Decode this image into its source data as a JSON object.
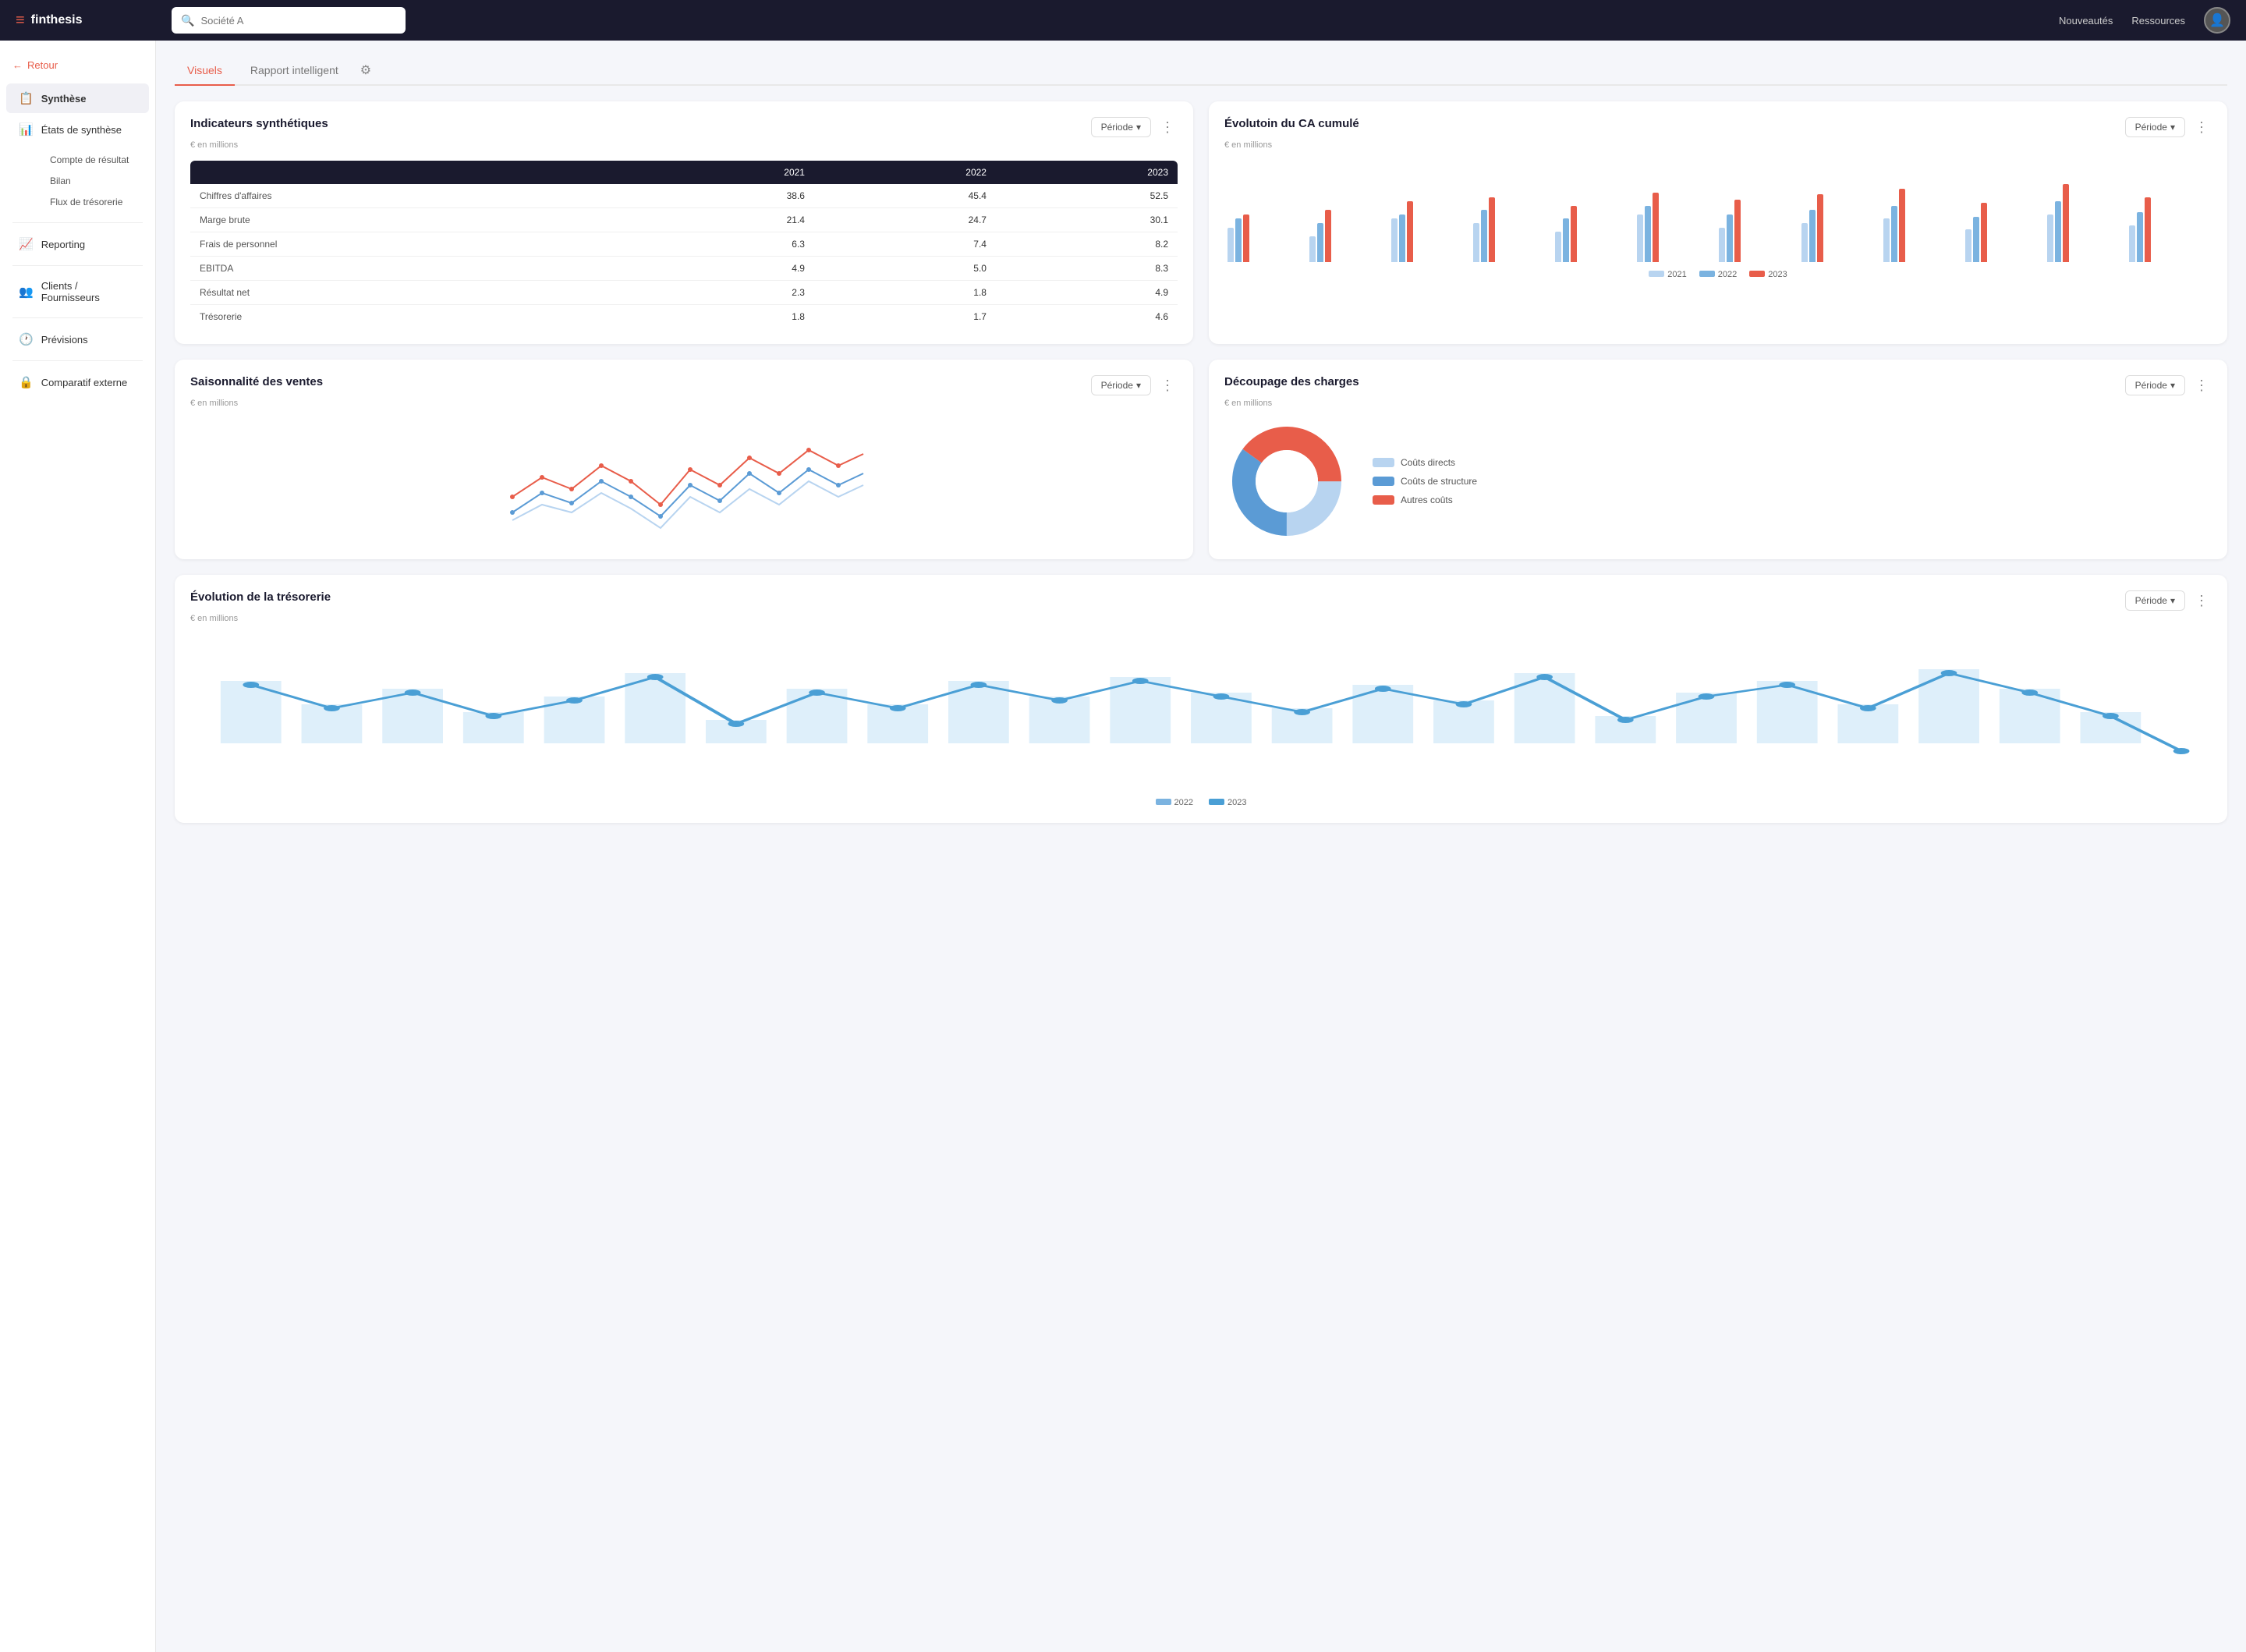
{
  "topnav": {
    "logo": "finthesis",
    "search_placeholder": "Société A",
    "nav_links": [
      "Nouveautés",
      "Ressources"
    ]
  },
  "sidebar": {
    "back_label": "Retour",
    "items": [
      {
        "id": "synthese",
        "label": "Synthèse",
        "active": true,
        "icon": "📋"
      },
      {
        "id": "etats",
        "label": "États de synthèse",
        "icon": "📊",
        "children": [
          "Compte de résultat",
          "Bilan",
          "Flux de trésorerie"
        ]
      },
      {
        "id": "reporting",
        "label": "Reporting",
        "icon": "📈"
      },
      {
        "id": "clients",
        "label": "Clients / Fournisseurs",
        "icon": "👥"
      },
      {
        "id": "previsions",
        "label": "Prévisions",
        "icon": "🕐"
      },
      {
        "id": "comparatif",
        "label": "Comparatif externe",
        "icon": "🔒"
      }
    ]
  },
  "tabs": {
    "items": [
      "Visuels",
      "Rapport intelligent"
    ],
    "active": 0
  },
  "indicateurs": {
    "title": "Indicateurs synthétiques",
    "subtitle": "€ en millions",
    "period_label": "Période",
    "columns": [
      "",
      "2021",
      "2022",
      "2023"
    ],
    "rows": [
      {
        "label": "Chiffres d'affaires",
        "v2021": "38.6",
        "v2022": "45.4",
        "v2023": "52.5"
      },
      {
        "label": "Marge brute",
        "v2021": "21.4",
        "v2022": "24.7",
        "v2023": "30.1"
      },
      {
        "label": "Frais de personnel",
        "v2021": "6.3",
        "v2022": "7.4",
        "v2023": "8.2"
      },
      {
        "label": "EBITDA",
        "v2021": "4.9",
        "v2022": "5.0",
        "v2023": "8.3"
      },
      {
        "label": "Résultat net",
        "v2021": "2.3",
        "v2022": "1.8",
        "v2023": "4.9"
      },
      {
        "label": "Trésorerie",
        "v2021": "1.8",
        "v2022": "1.7",
        "v2023": "4.6"
      }
    ]
  },
  "ca_cumule": {
    "title": "Évolutoin du CA cumulé",
    "subtitle": "€ en millions",
    "period_label": "Période",
    "legend": [
      "2021",
      "2022",
      "2023"
    ],
    "bar_groups": [
      {
        "y2021": 40,
        "y2022": 50,
        "y2023": 55
      },
      {
        "y2021": 30,
        "y2022": 45,
        "y2023": 60
      },
      {
        "y2021": 50,
        "y2022": 55,
        "y2023": 70
      },
      {
        "y2021": 45,
        "y2022": 60,
        "y2023": 75
      },
      {
        "y2021": 35,
        "y2022": 50,
        "y2023": 65
      },
      {
        "y2021": 55,
        "y2022": 65,
        "y2023": 80
      },
      {
        "y2021": 40,
        "y2022": 55,
        "y2023": 72
      },
      {
        "y2021": 45,
        "y2022": 60,
        "y2023": 78
      },
      {
        "y2021": 50,
        "y2022": 65,
        "y2023": 85
      },
      {
        "y2021": 38,
        "y2022": 52,
        "y2023": 68
      },
      {
        "y2021": 55,
        "y2022": 70,
        "y2023": 90
      },
      {
        "y2021": 42,
        "y2022": 58,
        "y2023": 75
      }
    ]
  },
  "saisonnalite": {
    "title": "Saisonnalité des ventes",
    "subtitle": "€ en millions",
    "period_label": "Période"
  },
  "charges": {
    "title": "Découpage des charges",
    "subtitle": "€ en millions",
    "period_label": "Période",
    "segments": [
      {
        "label": "Coûts directs",
        "color": "#b8d4f0",
        "pct": 25
      },
      {
        "label": "Coûts de structure",
        "color": "#5b9bd5",
        "pct": 35
      },
      {
        "label": "Autres coûts",
        "color": "#e85d4a",
        "pct": 40
      }
    ]
  },
  "tresorerie": {
    "title": "Évolution de la trésorerie",
    "subtitle": "€ en millions",
    "period_label": "Période",
    "legend": [
      "2022",
      "2023"
    ]
  }
}
